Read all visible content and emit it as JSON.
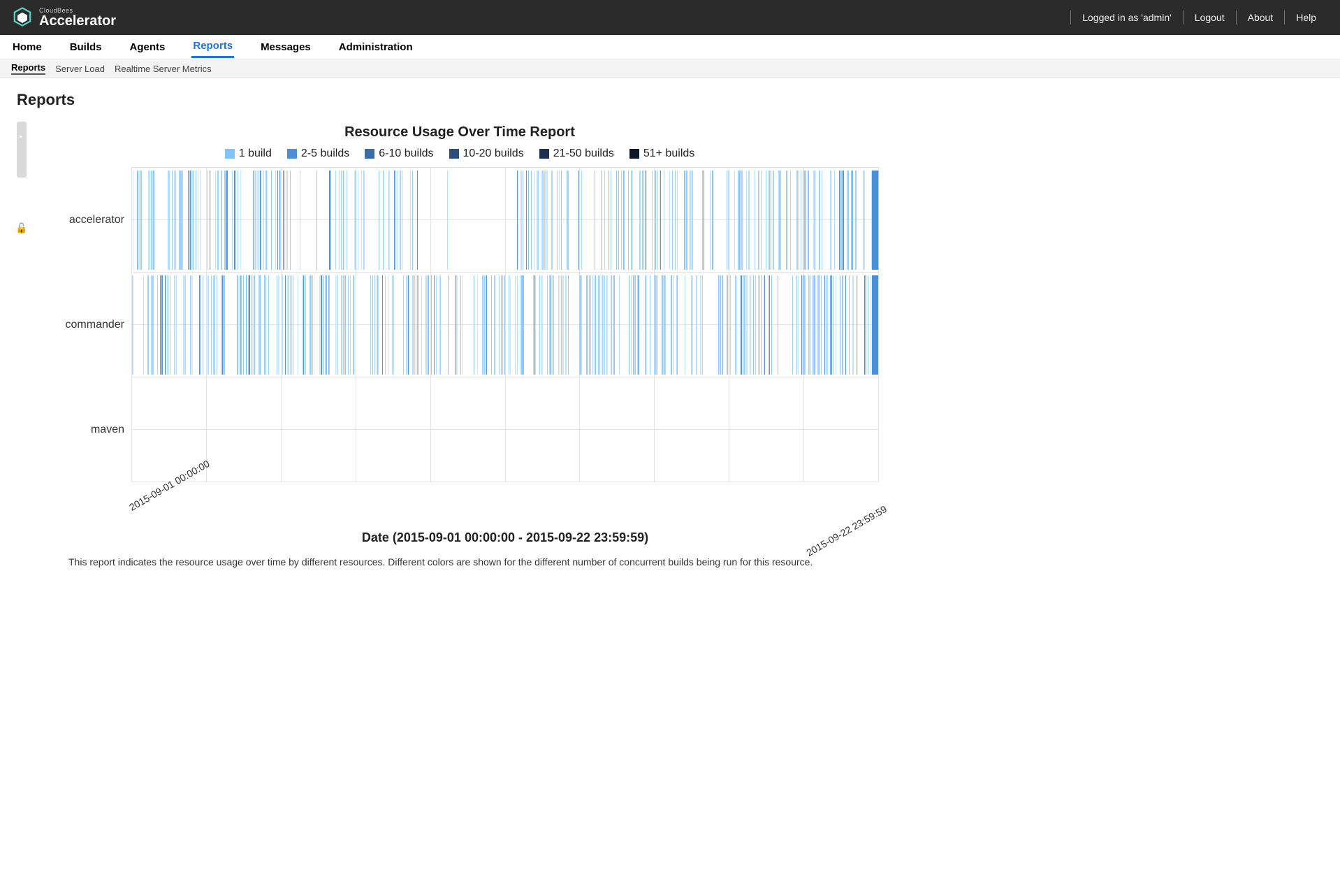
{
  "app": {
    "brand_small": "CloudBees",
    "brand_main": "Accelerator"
  },
  "topbar": {
    "logged_in_text": "Logged in as 'admin'",
    "logout": "Logout",
    "about": "About",
    "help": "Help"
  },
  "nav": {
    "items": [
      {
        "label": "Home",
        "active": false
      },
      {
        "label": "Builds",
        "active": false
      },
      {
        "label": "Agents",
        "active": false
      },
      {
        "label": "Reports",
        "active": true
      },
      {
        "label": "Messages",
        "active": false
      },
      {
        "label": "Administration",
        "active": false
      }
    ]
  },
  "subnav": {
    "items": [
      {
        "label": "Reports",
        "active": true
      },
      {
        "label": "Server Load",
        "active": false
      },
      {
        "label": "Realtime Server Metrics",
        "active": false
      }
    ]
  },
  "page": {
    "title": "Reports"
  },
  "chart_data": {
    "type": "heatmap",
    "title": "Resource Usage Over Time Report",
    "xlabel": "Date (2015-09-01 00:00:00 - 2015-09-22 23:59:59)",
    "xlim": [
      "2015-09-01 00:00:00",
      "2015-09-22 23:59:59"
    ],
    "x_tick_labels": [
      "2015-09-01 00:00:00",
      "2015-09-22 23:59:59"
    ],
    "categories": [
      "accelerator",
      "commander",
      "maven"
    ],
    "legend": [
      {
        "label": "1 build",
        "color": "#7fc3ff"
      },
      {
        "label": "2-5 builds",
        "color": "#4a8fd8"
      },
      {
        "label": "6-10 builds",
        "color": "#3a6ea8"
      },
      {
        "label": "10-20 builds",
        "color": "#2c4e7c"
      },
      {
        "label": "21-50 builds",
        "color": "#1d3250"
      },
      {
        "label": "51+ builds",
        "color": "#0e1928"
      }
    ],
    "grid": true,
    "notes": "Barcode-style heatmap; each row shows dense vertical stripes over the date range. 'accelerator' and 'commander' show heavy intermittent usage mostly in the 1-build to 2-5-build range with a solid bar at the far right; 'maven' is empty.",
    "series": [
      {
        "name": "accelerator",
        "density": 0.48,
        "sparse_region": [
          0.39,
          0.52
        ],
        "gaps": [
          [
            0.03,
            0.045
          ],
          [
            0.23,
            0.245
          ],
          [
            0.315,
            0.33
          ],
          [
            0.4,
            0.415
          ],
          [
            0.44,
            0.455
          ],
          [
            0.48,
            0.515
          ],
          [
            0.605,
            0.62
          ],
          [
            0.75,
            0.76
          ]
        ],
        "endcap_color": "#4a8fd8",
        "dominant_level": "1 build"
      },
      {
        "name": "commander",
        "density": 0.64,
        "sparse_region": null,
        "gaps": [
          [
            0.125,
            0.14
          ],
          [
            0.3,
            0.315
          ],
          [
            0.445,
            0.455
          ],
          [
            0.655,
            0.665
          ],
          [
            0.77,
            0.78
          ],
          [
            0.87,
            0.885
          ]
        ],
        "endcap_color": "#4a8fd8",
        "dominant_level": "1 build"
      },
      {
        "name": "maven",
        "density": 0.0,
        "sparse_region": null,
        "gaps": [],
        "endcap_color": null,
        "dominant_level": null
      }
    ]
  },
  "footnote": "This report indicates the resource usage over time by different resources. Different colors are shown for the different number of concurrent builds being run for this resource."
}
